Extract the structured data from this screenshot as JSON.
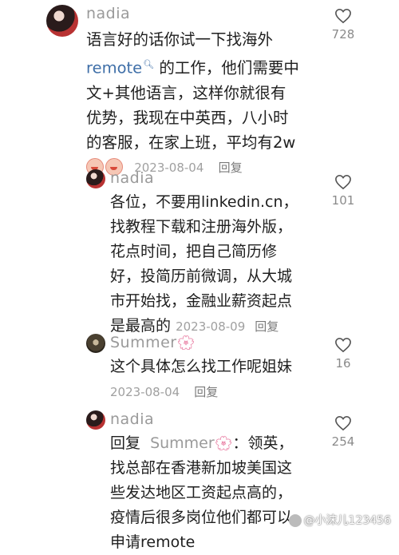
{
  "comments": [
    {
      "user": "nadia",
      "lines": [
        "语言好的话你试一下找海外",
        "的工作，他们需要中",
        "文+其他语言，这样你就很有",
        "优势，我现在中英西，八小时",
        "的客服，在家上班，平均有2w"
      ],
      "link_text": "remote",
      "date": "2023-08-04",
      "reply": "回复",
      "likes": "728"
    },
    {
      "user": "nadia",
      "lines": [
        "各位，不要用linkedin.cn，",
        "找教程下载和注册海外版，",
        "花点时间，把自己简历修",
        "好，投简历前微调，从大城",
        "市开始找，金融业薪资起点",
        "是最高的"
      ],
      "date": "2023-08-09",
      "reply": "回复",
      "likes": "101"
    },
    {
      "user": "Summer",
      "lines": [
        "这个具体怎么找工作呢姐妹"
      ],
      "date": "2023-08-04",
      "reply": "回复",
      "likes": "16"
    },
    {
      "user": "nadia",
      "reply_prefix": "回复",
      "reply_to": "Summer",
      "first_line_rest": "：领英，",
      "lines": [
        "找总部在香港新加坡美国这",
        "些发达地区工资起点高的，",
        "疫情后很多岗位他们都可以",
        "申请remote"
      ],
      "likes": "254"
    }
  ],
  "watermark": "@小沫儿123456",
  "icons": {
    "like": "heart-outline-icon",
    "search": "search-icon",
    "flower": "cherry-blossom-icon",
    "emoji": "crying-face-emoji-icon"
  }
}
